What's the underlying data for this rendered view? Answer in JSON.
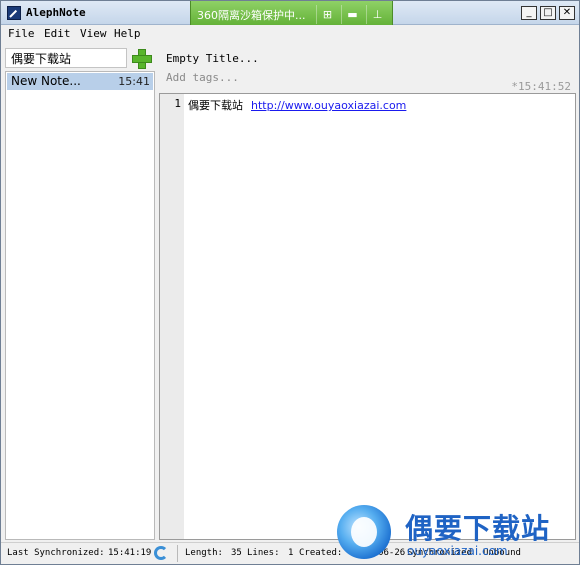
{
  "window": {
    "title": "AlephNote",
    "minimize": "_",
    "maximize": "□",
    "close": "✕"
  },
  "sandbox": {
    "text": "360隔离沙箱保护中..."
  },
  "menu": [
    {
      "label": "File"
    },
    {
      "label": "Edit"
    },
    {
      "label": "View"
    },
    {
      "label": "Help"
    }
  ],
  "sidebar": {
    "search_value": "偶要下载站",
    "notes": [
      {
        "title": "New Note...",
        "time": "15:41"
      }
    ]
  },
  "note": {
    "title_placeholder": "Empty Title...",
    "tags_placeholder": "Add tags...",
    "modified_time": "*15:41:52",
    "lines": [
      {
        "number": "1",
        "text": "偶要下载站",
        "link": "http://www.ouyaoxiazai.com"
      }
    ]
  },
  "status": {
    "last_sync_label": "Last Synchronized:",
    "last_sync_time": "15:41:19",
    "length_label": "Length:",
    "length_value": "35",
    "lines_label": "Lines:",
    "lines_value": "1",
    "created_label": "Created:",
    "created_value": "2018-06-26",
    "sync_status": "Synchronized",
    "other": "Unbound"
  },
  "watermark": {
    "brand": "偶要下载站",
    "url": "ouyaoxiazai.com"
  },
  "icons": [
    "app-icon",
    "pin-icon",
    "folder-icon",
    "minimize-icon",
    "maximize-icon",
    "close-icon",
    "add-note-icon",
    "sync-icon"
  ],
  "colors": {
    "selection": "#b8cfe9",
    "link": "#1a1aee",
    "sandbox_green": "#5fae33",
    "add_green": "#59b52d",
    "brand_blue": "#1f63c4"
  }
}
